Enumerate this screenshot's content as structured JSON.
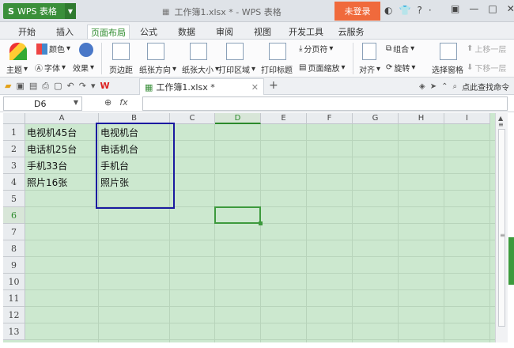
{
  "titlebar": {
    "app_logo": "S",
    "app_name": "WPS 表格",
    "doc_title": "工作簿1.xlsx * - WPS 表格",
    "login_label": "未登录"
  },
  "menu": {
    "tabs": [
      "开始",
      "插入",
      "页面布局",
      "公式",
      "数据",
      "审阅",
      "视图",
      "开发工具",
      "云服务"
    ],
    "active_tab": "页面布局"
  },
  "ribbon": {
    "theme": "主题",
    "color": "颜色",
    "font": "字体",
    "effect": "效果",
    "margins": "页边距",
    "orientation": "纸张方向",
    "paper_size": "纸张大小",
    "print_area": "打印区域",
    "print_titles": "打印标题",
    "page_break": "分页符",
    "page_zoom": "页面缩放",
    "align": "对齐",
    "group": "组合",
    "rotate": "旋转",
    "selection_pane": "选择窗格",
    "bring_forward": "上移一层",
    "send_backward": "下移一层"
  },
  "quickbar": {
    "doc_tab": "工作簿1.xlsx *",
    "search_command": "点此查找命令"
  },
  "formula": {
    "cell_ref": "D6",
    "fx": "fx",
    "value": ""
  },
  "sheet": {
    "columns": [
      "A",
      "B",
      "C",
      "D",
      "E",
      "F",
      "G",
      "H",
      "I"
    ],
    "selected_column": "D",
    "rows": [
      "1",
      "2",
      "3",
      "4",
      "5",
      "6",
      "7",
      "8",
      "9",
      "10",
      "11",
      "12",
      "13"
    ],
    "selected_row": "6",
    "cells": {
      "A1": "电视机45台",
      "A2": "电话机25台",
      "A3": "手机33台",
      "A4": "照片16张",
      "B1": "电视机台",
      "B2": "电话机台",
      "B3": "手机台",
      "B4": "照片张"
    }
  },
  "colors": {
    "accent_green": "#2b8a2b",
    "sheet_bg": "#cce8cf",
    "selection_box": "#1a1aa0",
    "login_orange": "#f06a3c"
  }
}
